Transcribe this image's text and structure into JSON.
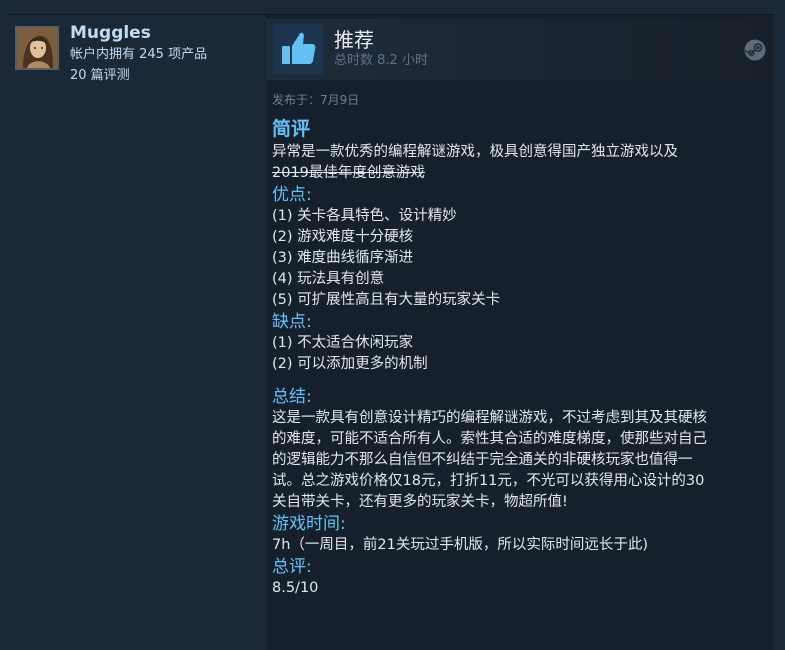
{
  "reviewer": {
    "name": "Muggles",
    "products_owned": "帐户内拥有 245 项产品",
    "review_count": "20 篇评测"
  },
  "review_header": {
    "verdict": "推荐",
    "hours": "总时数 8.2 小时",
    "verdict_icon": "thumbs-up-icon",
    "platform_icon": "steam-icon"
  },
  "posted": "发布于：7月9日",
  "body": {
    "intro_heading": "简评",
    "intro_line1": "异常是一款优秀的编程解谜游戏，极具创意得国产独立游戏以及",
    "intro_line2_struck": "2019最佳年度创意游戏",
    "pros_heading": "优点:",
    "pros": [
      "(1) 关卡各具特色、设计精妙",
      "(2) 游戏难度十分硬核",
      "(3) 难度曲线循序渐进",
      "(4) 玩法具有创意",
      "(5) 可扩展性高且有大量的玩家关卡"
    ],
    "cons_heading": "缺点:",
    "cons": [
      "(1) 不太适合休闲玩家",
      "(2) 可以添加更多的机制"
    ],
    "summary_heading": "总结:",
    "summary_lines": [
      "这是一款具有创意设计精巧的编程解谜游戏，不过考虑到其及其硬核",
      "的难度，可能不适合所有人。索性其合适的难度梯度，使那些对自己",
      "的逻辑能力不那么自信但不纠结于完全通关的非硬核玩家也值得一",
      "试。总之游戏价格仅18元，打折11元，不光可以获得用心设计的30",
      "关自带关卡，还有更多的玩家关卡，物超所值!"
    ],
    "playtime_heading": "游戏时间:",
    "playtime_text": "7h（一周目，前21关玩过手机版，所以实际时间远长于此)",
    "score_heading": "总评:",
    "score_text": "8.5/10"
  },
  "colors": {
    "page_bg": "#1b2838",
    "panel_bg": "#16202d",
    "link_blue": "#66c0f4",
    "name_blue": "#c1dbf4",
    "body_text": "#e0e7ee",
    "muted": "#6d7d91"
  }
}
